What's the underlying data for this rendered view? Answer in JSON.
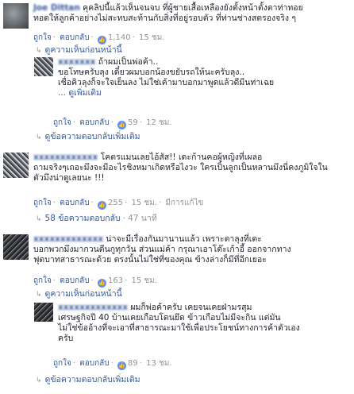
{
  "comments": [
    {
      "author": "Joe Dittan",
      "text_lines": [
        "คุคลิปนี้แล้วเห็นจนจบ ที่ผู้ชายเสื้อเหลืองยังตั้งหน้าตั้งตาท่าทอย",
        "ทอดให้ลูกค้าอย่างไม่สะทบสะท้านกับสิ่งที่อยู่รอบตัว ที่ท่านช่างสตรองจริง ๆ"
      ],
      "like": "ถูกใจ",
      "reply": "ตอบกลับ",
      "reactions": "1,140",
      "time": "15 ชม."
    },
    {
      "text_lines": [
        "ถ้าผมเป็นพ่อค้า..",
        "ขอโทษครับลุง เดี๋ยวผมบอกน้องขยับรถให้นะครับลุง..",
        "เชื่อคิวลุงก็จะใจเย็นลง ไม่ใช่เค้ามาบอกมาพูดแล้วดีมีนท่าเฉย",
        "... ดูเพิ่มเติม"
      ],
      "like": "ถูกใจ",
      "reply": "ตอบกลับ",
      "reactions": "59",
      "time": "12 ชม."
    },
    {
      "text_lines": [
        "โคตรแมนเลยไอ้สัส!! เดะก้านคอผู้หญิงที่เผลอ",
        "ถามจริงๆเถอะมึงจะมีอะไรชิงหมาเกิดหรือไงวะ ใครเป็นลูกเป็นหลานมึงนี่คงภูมิใจใน",
        "ตัวมึงน่าดูเลยนะ !!!"
      ],
      "like": "ถูกใจ",
      "reply": "ตอบกลับ",
      "reactions": "255",
      "time": "15 ชม.",
      "edited": "มีการแก้ไข"
    },
    {
      "text_lines": [
        "น่าจะมีเรื่องกันมานานแล้ว เพราะตาลุงที่เตะ",
        "บอกพวกมึงมากวนตีนกูทุกวัน ส่วนแม่ค้า กรุณาเอาโต๊ะเก้าอี้ ออกจากทาง",
        "ฟุตบาทสาธารณะด้วย ตรงนั้นไม่ใช่ที่ของคุณ ข้างล่างก็มีที่อีกเยอะ"
      ],
      "like": "ถูกใจ",
      "reply": "ตอบกลับ",
      "reactions": "163",
      "time": "15 ชม."
    },
    {
      "text_lines": [
        "ผมก็พ่อค้าครับ เคยจนเคยฝ่ามรสุม",
        "เศรษฐกิจปี 40 บ้านเคยเกือบโดนยึด ข้าวเกือบไม่มีจะกิน แต่มัน",
        "ไม่ใช่ข้ออ้างที่จะเอาที่สาธารณะมาใช้เพื่อประโยชน์ทางการค้าตัวเอง",
        "ครับ"
      ],
      "like": "ถูกใจ",
      "reply": "ตอบกลับ",
      "reactions": "89",
      "time": "13 ชม."
    }
  ],
  "links": {
    "prev_replies": "ดูความเห็นก่อนหน้านี้",
    "more_replies_1": "ดูข้อความตอบกลับเพิ่มเติม",
    "replies_58": "58 ข้อความตอบกลับ",
    "replies_58_time": "47 นาที",
    "prev_replies_2": "ดูความเห็นก่อนหน้านี้",
    "more_replies_2": "ดูข้อความตอบกลับเพิ่มเติม"
  },
  "colors": {
    "link": "#365899",
    "meta": "#90949c",
    "like_icon": "#5890ff"
  },
  "icons": {
    "like": "thumbs-up-icon",
    "reply_arrow": "reply-arrow-icon"
  }
}
